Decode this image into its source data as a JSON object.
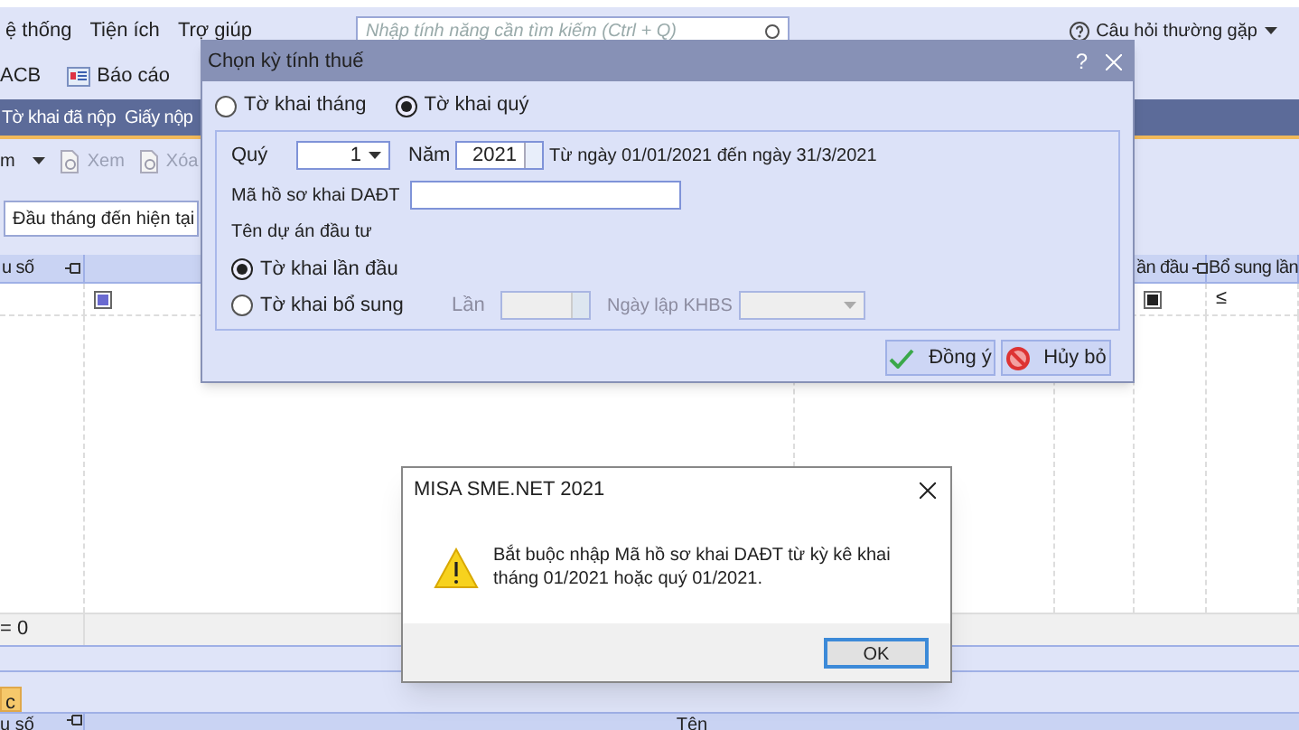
{
  "menu": {
    "items": [
      "ệ thống",
      "Tiện ích",
      "Trợ giúp"
    ],
    "search": {
      "placeholder": "Nhập tính năng cần tìm kiếm (Ctrl + Q)"
    },
    "help": "Câu hỏi thường gặp"
  },
  "toolbar": [
    {
      "label": "ACB",
      "kind": "text"
    },
    {
      "label": "Báo cáo",
      "kind": "report"
    }
  ],
  "tabs": [
    {
      "label": "Tờ khai đã nộp",
      "selected": false
    },
    {
      "label": "Giấy nộp",
      "selected": false
    }
  ],
  "actions": [
    {
      "label": "m",
      "kind": "menu",
      "disabled": false
    },
    {
      "label": "Xem",
      "kind": "view",
      "disabled": true
    },
    {
      "label": "Xóa",
      "kind": "delete",
      "disabled": true
    }
  ],
  "period_filter": {
    "value": "Đầu tháng đến hiện tại"
  },
  "grid": {
    "columns": [
      {
        "label": "u số",
        "pinned": true
      },
      {
        "label": "ần đầu",
        "pinned": true
      },
      {
        "label": "Bổ sung lần",
        "pinned": false
      }
    ],
    "rows": [
      {
        "selected": true,
        "first_time": true,
        "supplement": "≤"
      }
    ],
    "footer": "= 0"
  },
  "lower_panel": {
    "tab": "c",
    "columns": [
      {
        "label": "u số",
        "pinned": true
      },
      {
        "label": "Tên",
        "pinned": false
      }
    ]
  },
  "dialog": {
    "title": "Chọn kỳ tính thuế",
    "help": "?",
    "period_types": [
      {
        "label": "Tờ khai tháng",
        "selected": false
      },
      {
        "label": "Tờ khai quý",
        "selected": true
      }
    ],
    "quarter": {
      "label": "Quý",
      "value": "1"
    },
    "year": {
      "label": "Năm",
      "value": "2021"
    },
    "range": "Từ ngày 01/01/2021 đến ngày 31/3/2021",
    "code": {
      "label": "Mã hồ sơ khai DAĐT"
    },
    "project": {
      "label": "Tên dự án đầu tư"
    },
    "declaration_types": [
      {
        "label": "Tờ khai lần đầu",
        "selected": true
      },
      {
        "label": "Tờ khai bổ sung",
        "selected": false
      }
    ],
    "times": {
      "label": "Lần",
      "disabled": true
    },
    "khbs_date": {
      "label": "Ngày lập KHBS",
      "disabled": true
    },
    "buttons": [
      {
        "label": "Đồng ý",
        "kind": "ok"
      },
      {
        "label": "Hủy bỏ",
        "kind": "cancel"
      }
    ]
  },
  "message_box": {
    "title": "MISA SME.NET 2021",
    "text": "Bắt buộc nhập Mã hồ sơ khai DAĐT từ kỳ kê khai tháng 01/2021 hoặc quý 01/2021.",
    "button": "OK"
  }
}
